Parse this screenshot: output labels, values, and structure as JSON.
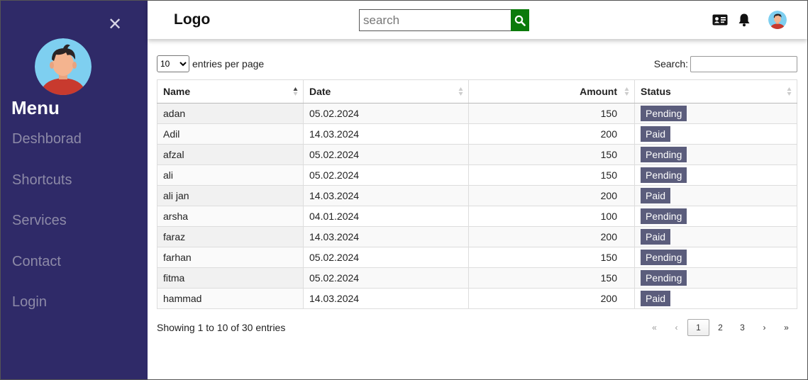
{
  "sidebar": {
    "close_glyph": "✕",
    "menu_title": "Menu",
    "items": [
      {
        "label": "Deshborad"
      },
      {
        "label": "Shortcuts"
      },
      {
        "label": "Services"
      },
      {
        "label": "Contact"
      },
      {
        "label": "Login"
      }
    ]
  },
  "header": {
    "logo": "Logo",
    "search_placeholder": "search",
    "icons": [
      "id-card-icon",
      "bell-icon",
      "avatar"
    ],
    "search_button_color": "#0b7a0b"
  },
  "table_controls": {
    "page_size": "10",
    "page_size_options": [
      "10"
    ],
    "entries_label": "entries per page",
    "search_label": "Search:",
    "search_value": ""
  },
  "table": {
    "columns": [
      "Name",
      "Date",
      "Amount",
      "Status"
    ],
    "sorted_column": "Name",
    "rows": [
      {
        "name": "adan",
        "date": "05.02.2024",
        "amount": "150",
        "status": "Pending"
      },
      {
        "name": "Adil",
        "date": "14.03.2024",
        "amount": "200",
        "status": "Paid"
      },
      {
        "name": "afzal",
        "date": "05.02.2024",
        "amount": "150",
        "status": "Pending"
      },
      {
        "name": "ali",
        "date": "05.02.2024",
        "amount": "150",
        "status": "Pending"
      },
      {
        "name": "ali jan",
        "date": "14.03.2024",
        "amount": "200",
        "status": "Paid"
      },
      {
        "name": "arsha",
        "date": "04.01.2024",
        "amount": "100",
        "status": "Pending"
      },
      {
        "name": "faraz",
        "date": "14.03.2024",
        "amount": "200",
        "status": "Paid"
      },
      {
        "name": "farhan",
        "date": "05.02.2024",
        "amount": "150",
        "status": "Pending"
      },
      {
        "name": "fitma",
        "date": "05.02.2024",
        "amount": "150",
        "status": "Pending"
      },
      {
        "name": "hammad",
        "date": "14.03.2024",
        "amount": "200",
        "status": "Paid"
      }
    ]
  },
  "footer": {
    "info": "Showing 1 to 10 of 30 entries",
    "pager": {
      "first": "«",
      "prev": "‹",
      "pages": [
        "1",
        "2",
        "3"
      ],
      "current_page": "1",
      "next": "›",
      "last": "»"
    }
  },
  "colors": {
    "sidebar_bg": "#2f2a68",
    "sidebar_link": "#8d8aa7",
    "badge_bg": "#5b5d7c",
    "search_button": "#0b7a0b"
  }
}
